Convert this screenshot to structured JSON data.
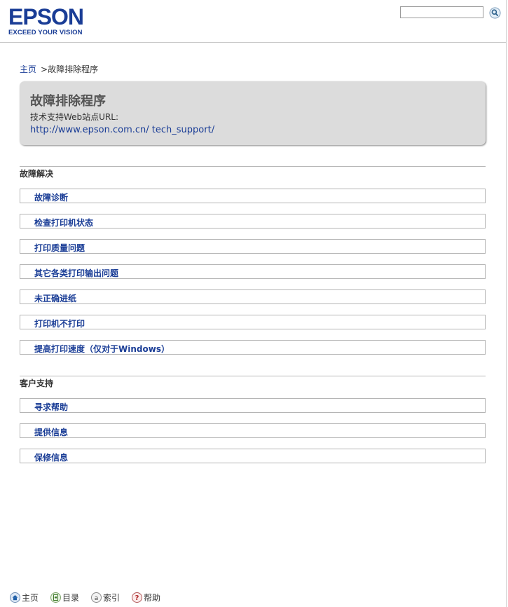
{
  "header": {
    "logo_text": "EPSON",
    "logo_tagline": "EXCEED YOUR VISION",
    "search": {
      "value": "",
      "placeholder": ""
    },
    "search_icon": "magnifier-icon"
  },
  "breadcrumb": {
    "home": "主页",
    "separator": ">",
    "current": "故障排除程序"
  },
  "title_box": {
    "title": "故障排除程序",
    "subtitle": "技术支持Web站点URL:",
    "link": "http://www.epson.com.cn/ tech_support/"
  },
  "sections": [
    {
      "heading": "故障解决",
      "items": [
        "故障诊断",
        "检查打印机状态",
        "打印质量问题",
        "其它各类打印输出问题",
        "未正确进纸",
        "打印机不打印",
        "提高打印速度（仅对于Windows）"
      ]
    },
    {
      "heading": "客户支持",
      "items": [
        "寻求帮助",
        "提供信息",
        "保修信息"
      ]
    }
  ],
  "footer": {
    "home": {
      "label": "主页",
      "icon": "home-icon"
    },
    "contents": {
      "label": "目录",
      "icon": "contents-icon"
    },
    "index": {
      "label": "索引",
      "icon": "index-icon"
    },
    "help": {
      "label": "帮助",
      "icon": "help-icon"
    }
  },
  "colors": {
    "link": "#1a3d96",
    "title_box_bg": "#dcdcdc",
    "border": "#b5b5b5"
  }
}
